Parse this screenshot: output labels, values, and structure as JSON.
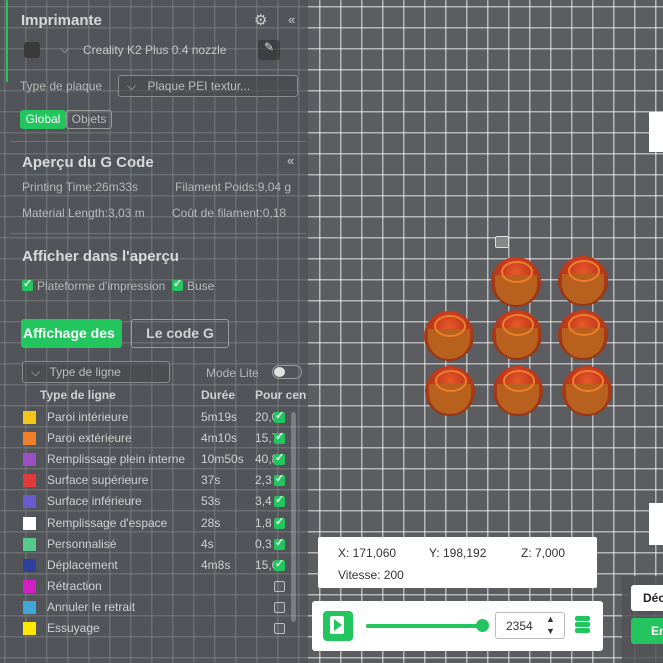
{
  "colors": {
    "accent": "#22c55e",
    "panel": "#4e5054",
    "grid": "#5c5d60"
  },
  "printer": {
    "section_title": "Imprimante",
    "printer_name": "Creality K2 Plus 0.4 nozzle",
    "plate_label": "Type de plaque",
    "plate_value": "Plaque PEI textur...",
    "tab_global": "Global",
    "tab_objects": "Objets"
  },
  "gcode_preview": {
    "title": "Aperçu du G Code",
    "printing_time": "Printing Time:26m33s",
    "filament_weight": "Filament Poids:9,04 g",
    "material_length": "Material Length:3,03 m",
    "filament_cost": "Coût de filament:0,18"
  },
  "display": {
    "title": "Afficher dans l'aperçu",
    "opt_plate": "Plateforme d'impression",
    "opt_nozzle": "Buse"
  },
  "view_tabs": {
    "display_tab": "Affichage des",
    "gcode_tab": "Le code G"
  },
  "filters": {
    "line_type_placeholder": "Type de ligne",
    "lite_mode": "Mode Lite"
  },
  "table": {
    "headers": [
      "Type de ligne",
      "Durée",
      "Pour cen"
    ],
    "rows": [
      {
        "color": "#f5c518",
        "label": "Paroi intérieure",
        "duration": "5m19s",
        "percent": "20,0",
        "checked": true
      },
      {
        "color": "#f07f2a",
        "label": "Paroi extérieure",
        "duration": "4m10s",
        "percent": "15,7",
        "checked": true
      },
      {
        "color": "#9b4fc7",
        "label": "Remplissage plein interne",
        "duration": "10m50s",
        "percent": "40,8",
        "checked": true
      },
      {
        "color": "#e23a3a",
        "label": "Surface supérieure",
        "duration": "37s",
        "percent": "2,3",
        "checked": true
      },
      {
        "color": "#6a5acd",
        "label": "Surface inférieure",
        "duration": "53s",
        "percent": "3,4",
        "checked": true
      },
      {
        "color": "#ffffff",
        "label": "Remplissage d'espace",
        "duration": "28s",
        "percent": "1,8",
        "checked": true
      },
      {
        "color": "#57c98a",
        "label": "Personnalisé",
        "duration": "4s",
        "percent": "0,3",
        "checked": true
      },
      {
        "color": "#2e3f9e",
        "label": "Déplacement",
        "duration": "4m8s",
        "percent": "15,6",
        "checked": true
      },
      {
        "color": "#d11fc4",
        "label": "Rétraction",
        "duration": "",
        "percent": "",
        "checked": false
      },
      {
        "color": "#3fa7d6",
        "label": "Annuler le retrait",
        "duration": "",
        "percent": "",
        "checked": false
      },
      {
        "color": "#ffe800",
        "label": "Essuyage",
        "duration": "",
        "percent": "",
        "checked": false
      }
    ]
  },
  "coords": {
    "x": "X: 171,060",
    "y": "Y: 198,192",
    "z": "Z: 7,000",
    "speed": "Vitesse: 200"
  },
  "playback": {
    "layer_value": "2354",
    "progress": 1.0
  },
  "right_buttons": {
    "label1": "Déc",
    "label2": "En"
  }
}
